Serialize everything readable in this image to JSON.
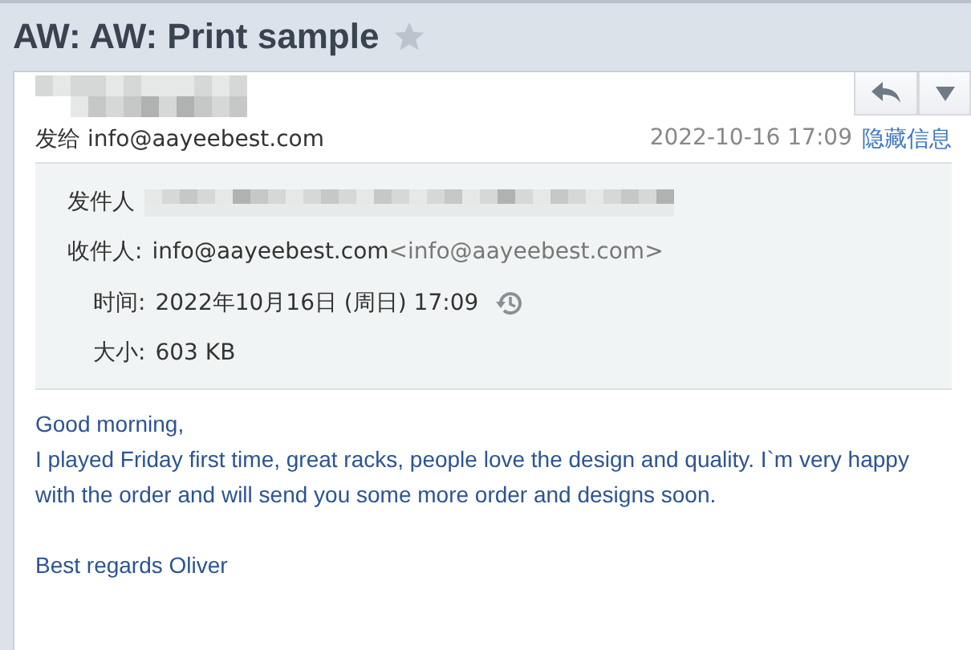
{
  "subject": {
    "title": "AW: AW: Print sample",
    "starred": false
  },
  "summary": {
    "to": "发给 info@aayeebest.com",
    "date": "2022-10-16 17:09",
    "hide_link": "隐藏信息"
  },
  "details": [
    {
      "kind": "sender",
      "label": "发件人"
    },
    {
      "kind": "recipient",
      "label": "收件人:",
      "value": "info@aayeebest.com",
      "address": "<info@aayeebest.com>"
    },
    {
      "kind": "time",
      "label": "时间:",
      "value": "2022年10月16日 (周日) 17:09"
    },
    {
      "kind": "size",
      "label": "大小:",
      "value": "603 KB"
    }
  ],
  "body": [
    "Good morning,\nI played Friday first time, great racks, people love the design and quality. I`m very happy with the order and will send you some more order and designs soon.",
    "Best regards Oliver"
  ]
}
